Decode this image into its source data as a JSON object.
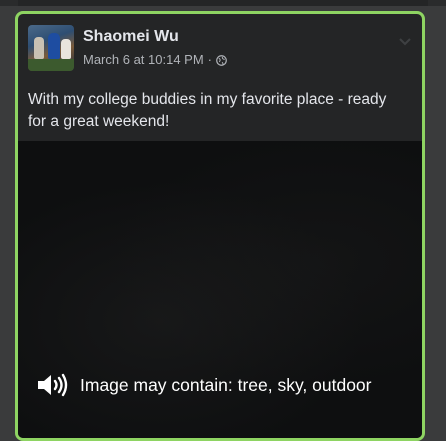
{
  "post": {
    "author": "Shaomei Wu",
    "timestamp": "March 6 at 10:14 PM",
    "separator": "·",
    "audience_icon": "globe-icon",
    "text": "With my college buddies in my favorite place - ready for a great weekend!",
    "media": {
      "alt_text": "Image may contain: tree, sky, outdoor",
      "alt_icon": "speaker-icon"
    }
  },
  "colors": {
    "focus_border": "#8ed462",
    "card_background": "#242526",
    "page_background": "#3a3b3c"
  }
}
